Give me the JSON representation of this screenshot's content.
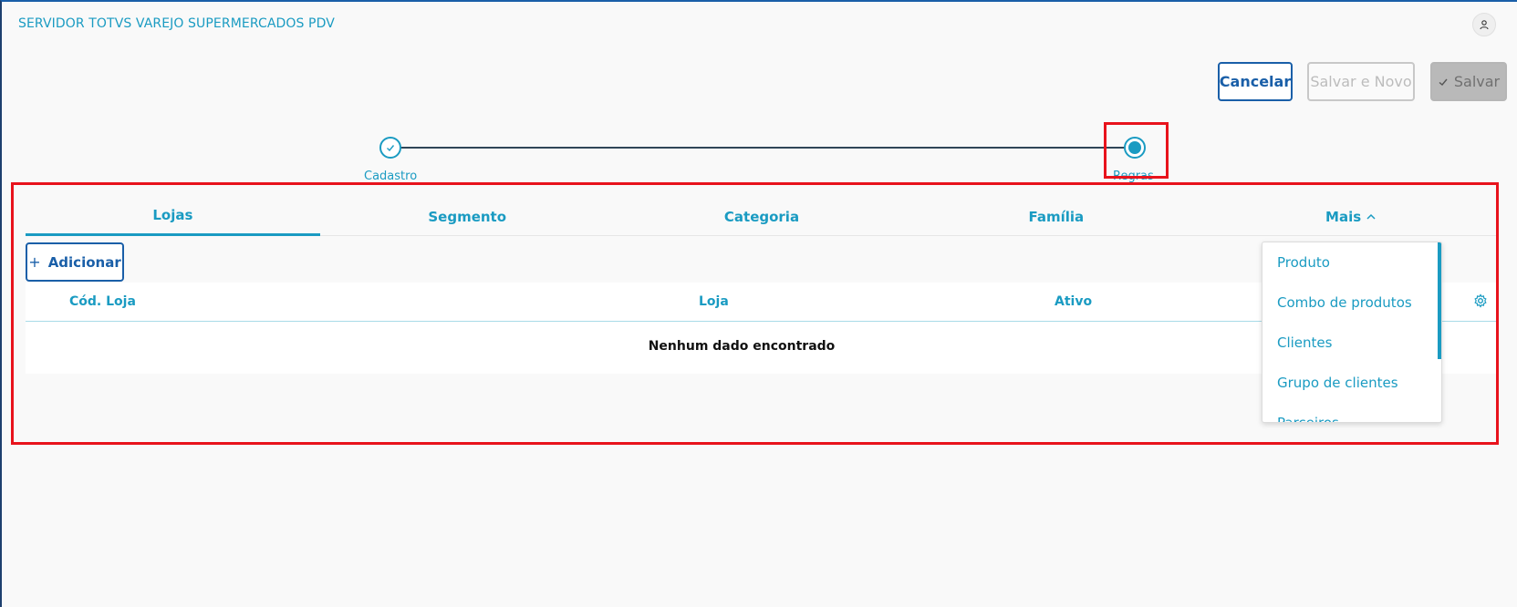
{
  "header": {
    "app_title": "SERVIDOR TOTVS VAREJO SUPERMERCADOS PDV"
  },
  "toolbar": {
    "cancel_label": "Cancelar",
    "save_new_label": "Salvar e Novo",
    "save_label": "Salvar"
  },
  "stepper": {
    "steps": [
      {
        "label": "Cadastro",
        "status": "done"
      },
      {
        "label": "Regras",
        "status": "active"
      }
    ]
  },
  "tabs": {
    "items": [
      {
        "label": "Lojas",
        "active": true
      },
      {
        "label": "Segmento"
      },
      {
        "label": "Categoria"
      },
      {
        "label": "Família"
      },
      {
        "label": "Mais"
      }
    ]
  },
  "actions": {
    "add_label": "Adicionar"
  },
  "table": {
    "columns": [
      "Cód. Loja",
      "Loja",
      "Ativo"
    ],
    "empty_text": "Nenhum dado encontrado"
  },
  "more_menu": {
    "items": [
      "Produto",
      "Combo de produtos",
      "Clientes",
      "Grupo de clientes",
      "Parceiros"
    ]
  },
  "colors": {
    "primary": "#1a9bc2",
    "accent": "#1a5fa8",
    "highlight": "#e8131c"
  }
}
